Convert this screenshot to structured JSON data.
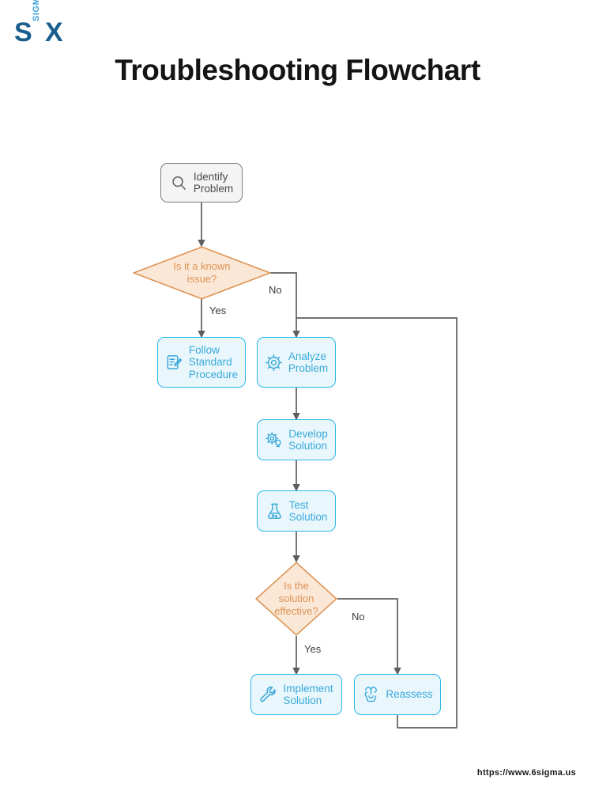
{
  "logo": {
    "s_letter": "S",
    "sigma_letter": "SIGMA",
    "x_letter": "X",
    "dark_blue": "#1a5e8e",
    "light_blue": "#3d9fd6"
  },
  "header": {
    "title": "Troubleshooting Flowchart"
  },
  "footer": {
    "url": "https://www.6sigma.us"
  },
  "colors": {
    "process_fill": "#e9f7fd",
    "process_border": "#2bb7e9",
    "process_text": "#3aa8d8",
    "decision_fill": "#fbe7d6",
    "decision_border": "#dd9455",
    "decision_text": "#dd9455",
    "start_fill": "#f4f4f4",
    "start_border": "#7d7d7d",
    "start_text": "#4a4a4a",
    "connector": "#5e5e5e",
    "title_text": "#141414"
  },
  "flowchart": {
    "nodes": [
      {
        "id": "identify-problem",
        "type": "start",
        "label": "Identify\nProblem",
        "icon": "magnifier-icon"
      },
      {
        "id": "known-issue",
        "type": "decision",
        "label": "Is it a known\nissue?"
      },
      {
        "id": "follow-standard-procedure",
        "type": "process",
        "label": "Follow\nStandard\nProcedure",
        "icon": "clipboard-edit-icon"
      },
      {
        "id": "analyze-problem",
        "type": "process",
        "label": "Analyze\nProblem",
        "icon": "gear-icon"
      },
      {
        "id": "develop-solution",
        "type": "process",
        "label": "Develop\nSolution",
        "icon": "gear-bulb-icon"
      },
      {
        "id": "test-solution",
        "type": "process",
        "label": "Test\nSolution",
        "icon": "flask-icon"
      },
      {
        "id": "solution-effective",
        "type": "decision",
        "label": "Is the\nsolution\neffective?"
      },
      {
        "id": "implement-solution",
        "type": "process",
        "label": "Implement\nSolution",
        "icon": "wrench-icon"
      },
      {
        "id": "reassess",
        "type": "process",
        "label": "Reassess",
        "icon": "brain-icon"
      }
    ],
    "edge_labels": {
      "known_issue_yes": "Yes",
      "known_issue_no": "No",
      "solution_effective_yes": "Yes",
      "solution_effective_no": "No"
    }
  }
}
